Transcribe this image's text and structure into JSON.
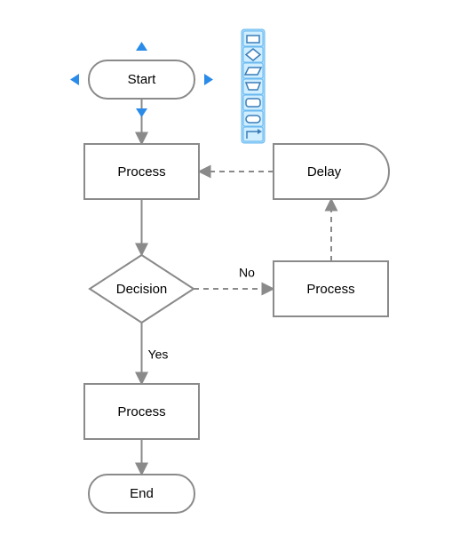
{
  "nodes": {
    "start": {
      "label": "Start"
    },
    "process1": {
      "label": "Process"
    },
    "decision": {
      "label": "Decision"
    },
    "process2": {
      "label": "Process"
    },
    "end": {
      "label": "End"
    },
    "process3": {
      "label": "Process"
    },
    "delay": {
      "label": "Delay"
    }
  },
  "edges": {
    "decision_no": {
      "label": "No"
    },
    "decision_yes": {
      "label": "Yes"
    }
  },
  "palette": {
    "items": [
      "rectangle-icon",
      "diamond-icon",
      "parallelogram-icon",
      "trapezoid-icon",
      "rounded-icon",
      "terminator-icon",
      "arrow-icon"
    ]
  }
}
